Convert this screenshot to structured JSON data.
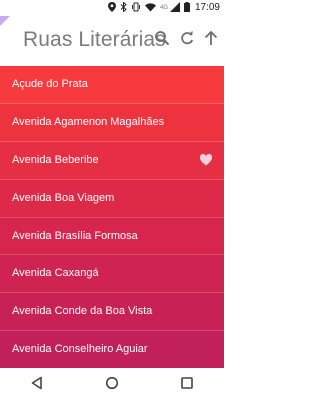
{
  "status_bar": {
    "network_label": "4G",
    "time": "17:09",
    "icons": [
      "location-icon",
      "bluetooth-icon",
      "vibrate-icon",
      "wifi-icon",
      "signal-icon",
      "battery-icon"
    ]
  },
  "app_bar": {
    "title": "Ruas Literárias",
    "actions": [
      "search-icon",
      "refresh-icon",
      "upload-icon"
    ],
    "corner_color": "#c9a9f3"
  },
  "streets": [
    {
      "name": "Açude do Prata",
      "color": "#f73a3d",
      "favorite": false
    },
    {
      "name": "Avenida Agamenon Magalhães",
      "color": "#ee3340",
      "favorite": false
    },
    {
      "name": "Avenida Beberibe",
      "color": "#e62e44",
      "favorite": true
    },
    {
      "name": "Avenida Boa Viagem",
      "color": "#de2a49",
      "favorite": false
    },
    {
      "name": "Avenida Brasília Formosa",
      "color": "#d6264e",
      "favorite": false
    },
    {
      "name": "Avenida Caxangá",
      "color": "#cf2352",
      "favorite": false
    },
    {
      "name": "Avenida Conde da Boa Vista",
      "color": "#c82156",
      "favorite": false
    },
    {
      "name": "Avenida Conselheiro Aguiar",
      "color": "#c1205a",
      "favorite": false
    }
  ],
  "nav_bar": {
    "icons": [
      "back-icon",
      "home-icon",
      "recents-icon"
    ]
  }
}
